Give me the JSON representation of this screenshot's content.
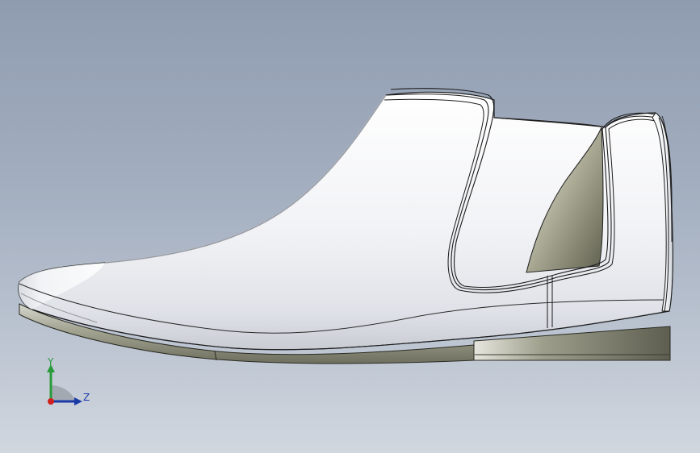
{
  "viewport": {
    "background_top": "#8f9cb0",
    "background_bottom": "#d1d7df"
  },
  "model": {
    "upper_color": "#eef0f3",
    "sole_color": "#8e8e7c",
    "heel_color": "#7b7b6a",
    "gusset_color": "#8a8a76",
    "edge_color": "#1a1a1a"
  },
  "triad": {
    "y_label": "Y",
    "z_label": "Z",
    "y_color": "#2a9a3a",
    "z_color": "#1a3aa8",
    "origin_color": "#d02020",
    "icon": "coordinate-triad-icon"
  }
}
